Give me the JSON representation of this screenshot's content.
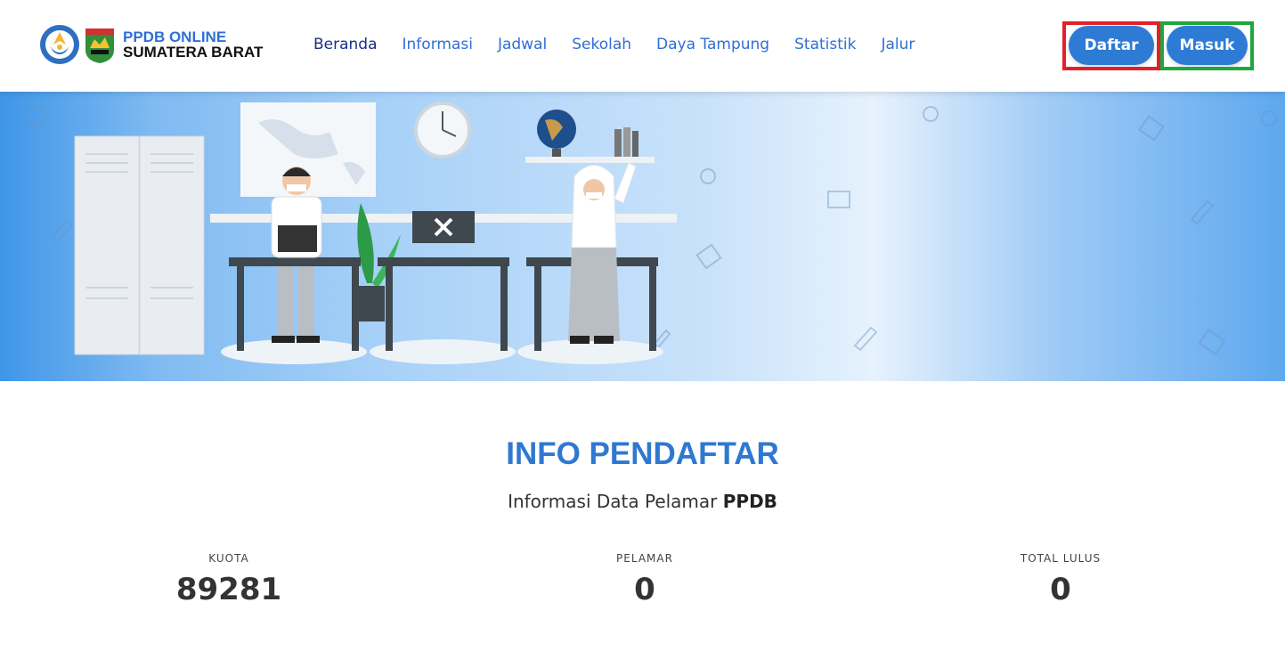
{
  "brand": {
    "line1": "PPDB ONLINE",
    "line2": "SUMATERA BARAT",
    "logo_left_icon": "tut-wuri-handayani-logo",
    "logo_right_icon": "sumatera-barat-crest"
  },
  "nav": [
    {
      "label": "Beranda",
      "active": true
    },
    {
      "label": "Informasi"
    },
    {
      "label": "Jadwal"
    },
    {
      "label": "Sekolah"
    },
    {
      "label": "Daya Tampung"
    },
    {
      "label": "Statistik"
    },
    {
      "label": "Jalur"
    }
  ],
  "buttons": {
    "register": "Daftar",
    "login": "Masuk"
  },
  "highlights": {
    "register_color": "#e3202a",
    "login_color": "#1ea73b"
  },
  "info": {
    "title": "INFO PENDAFTAR",
    "subtitle_prefix": "Informasi Data Pelamar",
    "subtitle_bold": "PPDB",
    "stats": [
      {
        "label": "KUOTA",
        "value": "89281"
      },
      {
        "label": "PELAMAR",
        "value": "0"
      },
      {
        "label": "TOTAL LULUS",
        "value": "0"
      }
    ]
  },
  "colors": {
    "accent": "#2f78d0",
    "nav_active": "#1b2f86",
    "button": "#2e7bd6"
  }
}
